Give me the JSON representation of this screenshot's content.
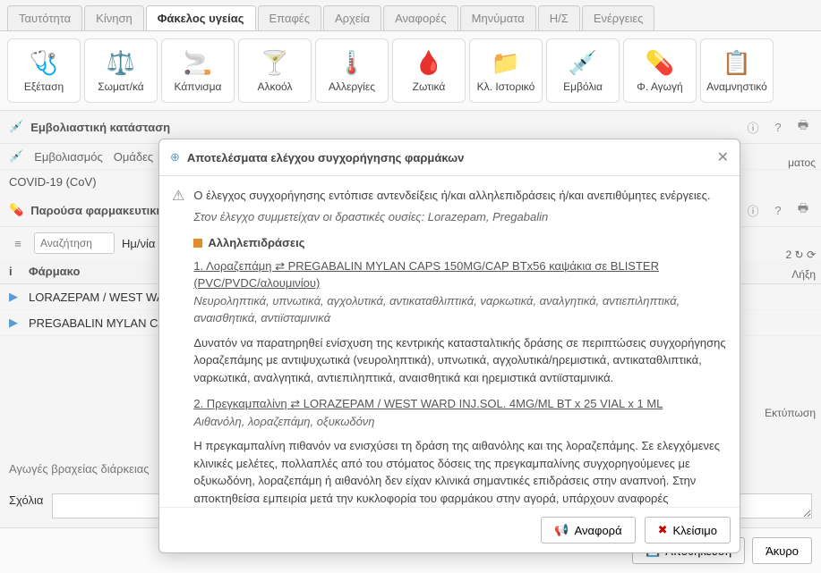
{
  "tabs": {
    "identity": "Ταυτότητα",
    "motion": "Κίνηση",
    "health_folder": "Φάκελος υγείας",
    "contacts": "Επαφές",
    "archives": "Αρχεία",
    "reports": "Αναφορές",
    "messages": "Μηνύματα",
    "hs": "Η/Σ",
    "actions": "Ενέργειες"
  },
  "toolbar": {
    "exam": "Εξέταση",
    "somat": "Σωματ/κά",
    "smoking": "Κάπνισμα",
    "alcohol": "Αλκοόλ",
    "allergies": "Αλλεργίες",
    "vitals": "Ζωτικά",
    "history": "Κλ. Ιστορικό",
    "vaccines": "Εμβόλια",
    "pharma": "Φ. Αγωγή",
    "anamn": "Αναμνηστικό"
  },
  "section1": {
    "title": "Εμβολιαστική κατάσταση"
  },
  "subtabs": {
    "vaccination": "Εμβολιασμός",
    "groups": "Ομάδες"
  },
  "covid": "COVID-19 (CoV)",
  "section2": {
    "title": "Παρούσα φαρμακευτική αγωγή"
  },
  "filter": {
    "search_ph": "Αναζήτηση",
    "date_label": "Ημ/νία"
  },
  "table": {
    "col_i": "i",
    "col_drug": "Φάρμακο",
    "col_end": "Λήξη",
    "row1": "LORAZEPAM / WEST WARD",
    "row2": "PREGABALIN MYLAN CAPS"
  },
  "side": {
    "treatment": "ματος",
    "print": "Εκτύπωση",
    "nums": "2  ↻  ⟳"
  },
  "short_treatment": "Αγωγές βραχείας διάρκειας",
  "comments_label": "Σχόλια",
  "footer": {
    "save": "Αποθήκευση",
    "cancel": "Άκυρο"
  },
  "modal": {
    "title": "Αποτελέσματα ελέγχου συγχορήγησης φαρμάκων",
    "intro": "Ο έλεγχος συγχορήγησης εντόπισε αντενδείξεις ή/και αλληλεπιδράσεις ή/και ανεπιθύμητες ενέργειες.",
    "sub": "Στον έλεγχο συμμετείχαν οι δραστικές ουσίες: Lorazepam, Pregabalin",
    "sect_title": "Αλληλεπιδράσεις",
    "int1_title": "1. Λοραζεπάμη ⇄ PREGABALIN MYLAN CAPS 150MG/CAP BTx56 καψάκια σε BLISTER (PVC/PVDC/αλουμινίου)",
    "int1_cat": "Νευροληπτικά, υπνωτικά, αγχολυτικά, αντικαταθλιπτικά, ναρκωτικά, αναλγητικά, αντιεπιληπτικά, αναισθητικά, αντιϊσταμινικά",
    "int1_body": "Δυνατόν να παρατηρηθεί ενίσχυση της κεντρικής κατασταλτικής δράσης σε περιπτώσεις συγχορήγησης λοραζεπάμης με αντιψυχωτικά (νευροληπτικά), υπνωτικά, αγχολυτικά/ηρεμιστικά, αντικαταθλιπτικά, ναρκωτικά, αναλγητικά, αντιεπιληπτικά, αναισθητικά και ηρεμιστικά αντιϊσταμινικά.",
    "int2_title": "2. Πρεγκαμπαλίνη ⇄ LORAZEPAM / WEST WARD INJ.SOL. 4MG/ML BT x 25 VIAL x 1 ML",
    "int2_cat": "Αιθανόλη, λοραζεπάμη, οξυκωδόνη",
    "int2_body": "Η πρεγκαμπαλίνη πιθανόν να ενισχύσει τη δράση της αιθανόλης και της λοραζεπάμης. Σε ελεγχόμενες κλινικές μελέτες, πολλαπλές από του στόματος δόσεις της πρεγκαμπαλίνης συγχορηγούμενες με οξυκωδόνη, λοραζεπάμη ή αιθανόλη δεν είχαν κλινικά σημαντικές επιδράσεις στην αναπνοή. Στην αποκτηθείσα εμπειρία μετά την κυκλοφορία του φαρμάκου στην αγορά, υπάρχουν αναφορές αναπνευστικής ανεπάρκειας και κώματος σε ασθενείς οι οποίοι λαμβάνουν πρεγκαμπαλίνη και άλλα φάρμακα καταστολής του ΚΝΣ. Η πρεγκαμπαλίνη φαίνεται ότι δρα αθροιστικά επί της δράσης της οξυκωδόνης στην έκπτωση της νοητικής και της συνολικής κινητικής λειτουργίας.",
    "report_btn": "Αναφορά",
    "close_btn": "Κλείσιμο"
  }
}
